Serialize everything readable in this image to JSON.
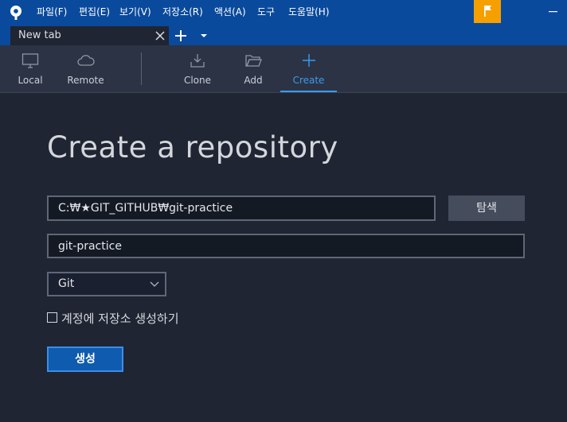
{
  "menu": {
    "items": [
      "파일(F)",
      "편집(E)",
      "보기(V)",
      "저장소(R)",
      "액션(A)",
      "도구",
      "도움말(H)"
    ]
  },
  "tabs": {
    "active_label": "New tab"
  },
  "toolbar": {
    "local": "Local",
    "remote": "Remote",
    "clone": "Clone",
    "add": "Add",
    "create": "Create"
  },
  "form": {
    "title": "Create a repository",
    "path_value": "C:₩★GIT_GITHUB₩git-practice",
    "browse_label": "탐색",
    "name_value": "git-practice",
    "vcs_selected": "Git",
    "create_remote_label": "계정에 저장소 생성하기",
    "create_remote_checked": false,
    "submit_label": "생성"
  },
  "colors": {
    "titlebar": "#0a4a9c",
    "background": "#1f2532",
    "accent": "#3a9bf0",
    "flag": "#f5a000"
  },
  "icons": {
    "logo": "sourcetree-logo-icon",
    "flag": "flag-icon",
    "local": "monitor-icon",
    "remote": "cloud-icon",
    "clone": "download-tray-icon",
    "add": "folder-open-icon",
    "create": "plus-icon"
  }
}
